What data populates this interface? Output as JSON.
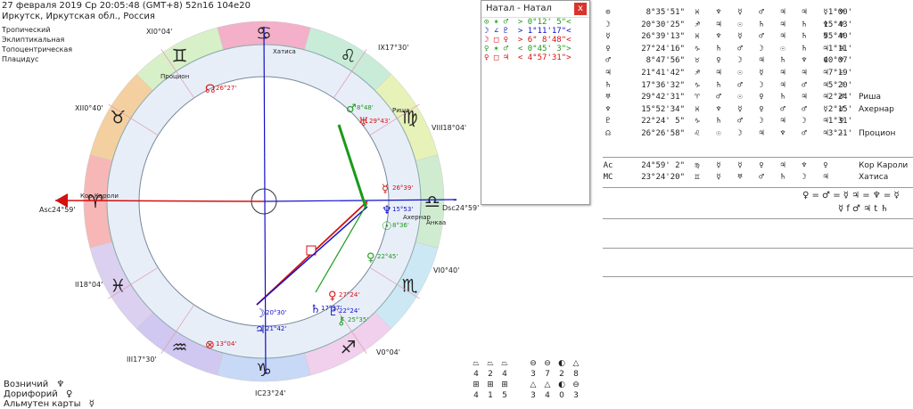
{
  "header": {
    "line1": "27 февраля 2019  Ср  20:05:48 (GMT+8) 52n16  104e20",
    "line2": "Иркутск, Иркутская обл., Россия"
  },
  "settings": [
    "Тропический",
    "Эклиптикальная",
    "Топоцентрическая",
    "Плацидус"
  ],
  "wheel": {
    "houses": [
      {
        "label": "Asc",
        "deg": "24°59'"
      },
      {
        "label": "II",
        "deg": "18°04'"
      },
      {
        "label": "III",
        "deg": "17°30'"
      },
      {
        "label": "IC",
        "deg": "23°24'"
      },
      {
        "label": "V",
        "deg": "0°04'"
      },
      {
        "label": "VI",
        "deg": "0°40'"
      },
      {
        "label": "Dsc",
        "deg": "24°59'"
      },
      {
        "label": "VIII",
        "deg": "18°04'"
      },
      {
        "label": "IX",
        "deg": "17°30'"
      },
      {
        "label": "XI",
        "deg": "0°04'"
      },
      {
        "label": "XII",
        "deg": "0°40'"
      }
    ],
    "signs": [
      "♋",
      "♊",
      "♉",
      "♈",
      "♓",
      "♒",
      "♑",
      "♐",
      "♏",
      "♎",
      "♍",
      "♌"
    ],
    "star_labels": [
      "Процион",
      "Хатиса",
      "Риша",
      "Кор Кароли",
      "Ахернар",
      "Анкаа"
    ],
    "planets": [
      {
        "glyph": "♂",
        "deg": "8°48'",
        "color": "#1a9a1a"
      },
      {
        "glyph": "♅",
        "deg": "29°43'",
        "color": "#d41010"
      },
      {
        "glyph": "☊",
        "deg": "26°27'",
        "color": "#d41010"
      },
      {
        "glyph": "☿",
        "deg": "26°39'",
        "color": "#d41010"
      },
      {
        "glyph": "♆",
        "deg": "15°53'",
        "color": "#1010c8"
      },
      {
        "glyph": "☉",
        "deg": "8°36'",
        "color": "#1a9a1a"
      },
      {
        "glyph": "♀",
        "deg": "22°45'",
        "color": "#1a9a1a"
      },
      {
        "glyph": "♀",
        "deg": "27°24'",
        "color": "#d41010"
      },
      {
        "glyph": "♄",
        "deg": "17°37'",
        "color": "#1010c8"
      },
      {
        "glyph": "♇",
        "deg": "22°24'",
        "color": "#1010c8"
      },
      {
        "glyph": "⚷",
        "deg": "25°35'",
        "color": "#1a9a1a"
      },
      {
        "glyph": "☽",
        "deg": "20°30'",
        "color": "#1010c8"
      },
      {
        "glyph": "♃",
        "deg": "21°42'",
        "color": "#1010c8"
      },
      {
        "glyph": "⊗",
        "deg": "13°04'",
        "color": "#d41010"
      }
    ]
  },
  "popup": {
    "title": "Натал - Натал",
    "close": "x",
    "rows": [
      {
        "text": "⊙ ✶ ♂  > 0°12' 5\"<",
        "color": "#1a9a1a"
      },
      {
        "text": "☽ ∠ ♇  > 1°11'17\"<",
        "color": "#1010c8"
      },
      {
        "text": "☽ □ ♀  > 6° 8'48\"<",
        "color": "#d41010"
      },
      {
        "text": "♀ ✶ ♂  < 0°45' 3\">",
        "color": "#1a9a1a"
      },
      {
        "text": "♀ □ ♃  < 4°57'31\">",
        "color": "#d41010"
      }
    ]
  },
  "aspects_table": {
    "rows": [
      {
        "planet": "⊙",
        "pos": "8°35'51\"",
        "signs": [
          "♓",
          "♆",
          "☿",
          "♂",
          "♃",
          "♃",
          "☿",
          "♆"
        ],
        "aspect": "1°00'",
        "name": ""
      },
      {
        "planet": "☽",
        "pos": "20°30'25\"",
        "signs": [
          "♐",
          "♃",
          "☉",
          "♄",
          "♃",
          "♄",
          "♆",
          "♅"
        ],
        "aspect": "15°43'",
        "name": ""
      },
      {
        "planet": "☿",
        "pos": "26°39'13\"",
        "signs": [
          "♓",
          "♆",
          "☿",
          "♂",
          "♃",
          "♄",
          "♅",
          "♅"
        ],
        "aspect": "55°40'",
        "name": ""
      },
      {
        "planet": "♀",
        "pos": "27°24'16\"",
        "signs": [
          "♑",
          "♄",
          "♂",
          "☽",
          "☉",
          "♄",
          "♃",
          "♃"
        ],
        "aspect": "1°11'",
        "name": ""
      },
      {
        "planet": "♂",
        "pos": "8°47'56\"",
        "signs": [
          "♉",
          "♀",
          "☽",
          "♃",
          "♄",
          "♆",
          "♀",
          "♆"
        ],
        "aspect": "40°07'",
        "name": ""
      },
      {
        "planet": "♃",
        "pos": "21°41'42\"",
        "signs": [
          "♐",
          "♃",
          "☉",
          "☿",
          "♃",
          "♃",
          "♃",
          "☉"
        ],
        "aspect": "7°19'",
        "name": ""
      },
      {
        "planet": "♄",
        "pos": "17°36'32\"",
        "signs": [
          "♑",
          "♄",
          "♂",
          "☽",
          "♃",
          "♂",
          "♃",
          "☽"
        ],
        "aspect": "5°20'",
        "name": ""
      },
      {
        "planet": "♅",
        "pos": "29°42'31\"",
        "signs": [
          "♈",
          "♂",
          "☉",
          "♀",
          "♄",
          "♃",
          "♃",
          "♂"
        ],
        "aspect": "2°24'",
        "name": "Риша"
      },
      {
        "planet": "♆",
        "pos": "15°52'34\"",
        "signs": [
          "♓",
          "♆",
          "☿",
          "♀",
          "♂",
          "♂",
          "☿",
          "♂"
        ],
        "aspect": "2°15'",
        "name": "Ахернар"
      },
      {
        "planet": "♇",
        "pos": "22°24' 5\"",
        "signs": [
          "♑",
          "♄",
          "♂",
          "☽",
          "♃",
          "☽",
          "♃",
          "♀"
        ],
        "aspect": "1°31'",
        "name": ""
      },
      {
        "planet": "☊",
        "pos": "26°26'58\"",
        "signs": [
          "♌",
          "☉",
          "☽",
          "♃",
          "♆",
          "♂",
          "♃",
          "-"
        ],
        "aspect": "3°21'",
        "name": "Процион"
      }
    ],
    "angles": [
      {
        "planet": "Ac",
        "pos": "24°59' 2\"",
        "signs": [
          "♍",
          "☿",
          "☿",
          "♀",
          "♃",
          "♆",
          "♀"
        ],
        "name": "Кор Кароли"
      },
      {
        "planet": "MC",
        "pos": "23°24'20\"",
        "signs": [
          "♊",
          "☿",
          "♅",
          "♂",
          "♄",
          "☽",
          "♃"
        ],
        "name": "Хатиса"
      }
    ],
    "eq1": "♀ = ♂ = ☿ ♃ = ♆ = ☿",
    "eq2": "☿ f ♂ ♃ t ♄"
  },
  "legend": [
    {
      "label": "Возничий",
      "glyph": "♆"
    },
    {
      "label": "Дорифорий",
      "glyph": "♀"
    },
    {
      "label": "Альмутен карты",
      "glyph": "☿"
    }
  ],
  "bottom_grid": {
    "group1": {
      "icons": [
        "⏢",
        "⏢",
        "⏢",
        "⊞",
        "⊞",
        "⊞"
      ],
      "numbers": [
        "4",
        "2",
        "4",
        "4",
        "1",
        "5"
      ]
    },
    "group2": {
      "icons": [
        "⊖",
        "⊖",
        "◐",
        "△",
        "△",
        "◐"
      ],
      "numbers": [
        "3",
        "7",
        "2",
        "8",
        "3",
        "4",
        "0",
        "3"
      ]
    }
  }
}
